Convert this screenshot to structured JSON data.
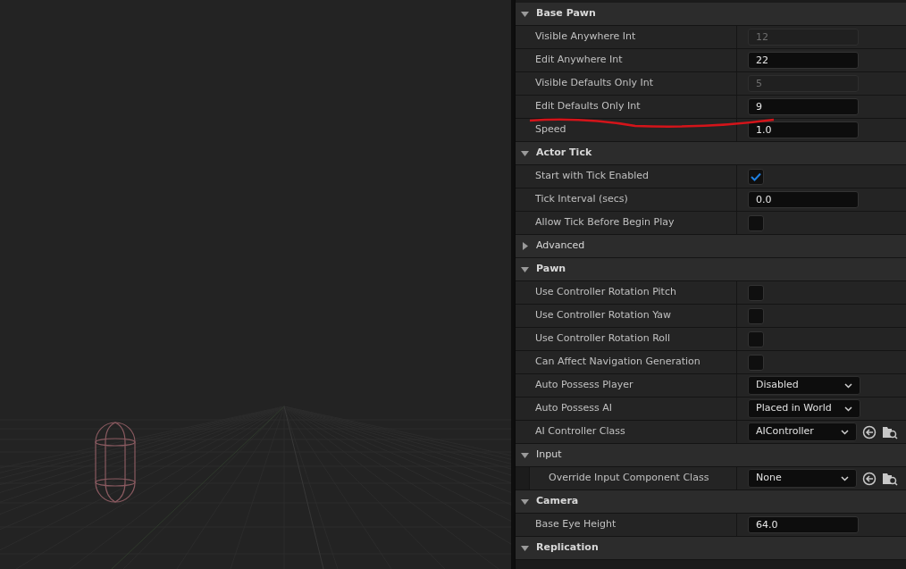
{
  "sections": [
    {
      "title": "Base Pawn",
      "kind": "category",
      "expanded": true,
      "rows": [
        {
          "label": "Visible Anywhere Int",
          "kind": "number",
          "value": "12",
          "disabled": true
        },
        {
          "label": "Edit Anywhere Int",
          "kind": "number",
          "value": "22",
          "disabled": false
        },
        {
          "label": "Visible Defaults Only Int",
          "kind": "number",
          "value": "5",
          "disabled": true
        },
        {
          "label": "Edit Defaults Only Int",
          "kind": "number",
          "value": "9",
          "disabled": false
        },
        {
          "label": "Speed",
          "kind": "number",
          "value": "1.0",
          "disabled": false
        }
      ]
    },
    {
      "title": "Actor Tick",
      "kind": "category",
      "expanded": true,
      "rows": [
        {
          "label": "Start with Tick Enabled",
          "kind": "check",
          "checked": true
        },
        {
          "label": "Tick Interval (secs)",
          "kind": "number",
          "value": "0.0",
          "disabled": false
        },
        {
          "label": "Allow Tick Before Begin Play",
          "kind": "check",
          "checked": false
        }
      ]
    },
    {
      "title": "Advanced",
      "kind": "group",
      "expanded": false
    },
    {
      "title": "Pawn",
      "kind": "category",
      "expanded": true,
      "rows": [
        {
          "label": "Use Controller Rotation Pitch",
          "kind": "check",
          "checked": false
        },
        {
          "label": "Use Controller Rotation Yaw",
          "kind": "check",
          "checked": false
        },
        {
          "label": "Use Controller Rotation Roll",
          "kind": "check",
          "checked": false
        },
        {
          "label": "Can Affect Navigation Generation",
          "kind": "check",
          "checked": false
        },
        {
          "label": "Auto Possess Player",
          "kind": "combo",
          "value": "Disabled"
        },
        {
          "label": "Auto Possess AI",
          "kind": "combo",
          "value": "Placed in World"
        },
        {
          "label": "AI Controller Class",
          "kind": "class",
          "value": "AIController"
        }
      ]
    },
    {
      "title": "Input",
      "kind": "group",
      "expanded": true,
      "rows": [
        {
          "label": "Override Input Component Class",
          "kind": "class",
          "value": "None"
        }
      ]
    },
    {
      "title": "Camera",
      "kind": "category",
      "expanded": true,
      "rows": [
        {
          "label": "Base Eye Height",
          "kind": "number",
          "value": "64.0",
          "disabled": false
        }
      ]
    },
    {
      "title": "Replication",
      "kind": "category",
      "expanded": true
    }
  ]
}
